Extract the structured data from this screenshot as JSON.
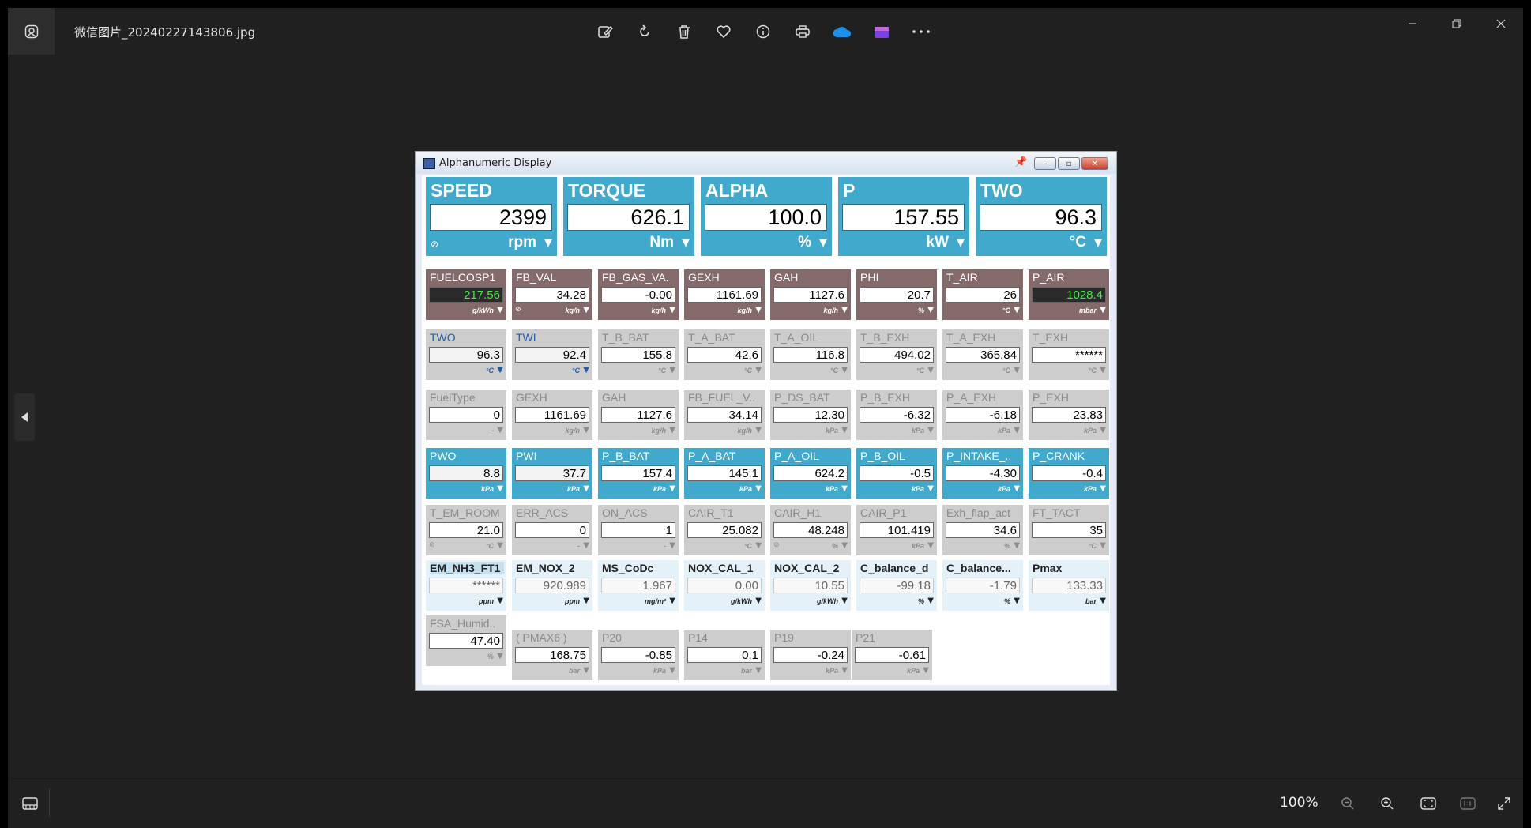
{
  "viewer": {
    "file_name": "微信图片_20240227143806.jpg",
    "zoom": "100%"
  },
  "app": {
    "title": "Alphanumeric Display"
  },
  "big": [
    {
      "label": "SPEED",
      "value": "2399",
      "unit": "rpm"
    },
    {
      "label": "TORQUE",
      "value": "626.1",
      "unit": "Nm"
    },
    {
      "label": "ALPHA",
      "value": "100.0",
      "unit": "%"
    },
    {
      "label": "P",
      "value": "157.55",
      "unit": "kW"
    },
    {
      "label": "TWO",
      "value": "96.3",
      "unit": "°C"
    }
  ],
  "row1": [
    {
      "label": "FUELCOSP1",
      "value": "217.56",
      "unit": "g/kWh"
    },
    {
      "label": "FB_VAL",
      "value": "34.28",
      "unit": "kg/h"
    },
    {
      "label": "FB_GAS_VA.",
      "value": "-0.00",
      "unit": "kg/h"
    },
    {
      "label": "GEXH",
      "value": "1161.69",
      "unit": "kg/h"
    },
    {
      "label": "GAH",
      "value": "1127.6",
      "unit": "kg/h"
    },
    {
      "label": "PHI",
      "value": "20.7",
      "unit": "%"
    },
    {
      "label": "T_AIR",
      "value": "26",
      "unit": "°C"
    },
    {
      "label": "P_AIR",
      "value": "1028.4",
      "unit": "mbar"
    }
  ],
  "row2": [
    {
      "label": "TWO",
      "value": "96.3",
      "unit": "°C"
    },
    {
      "label": "TWI",
      "value": "92.4",
      "unit": "°C"
    },
    {
      "label": "T_B_BAT",
      "value": "155.8",
      "unit": "°C"
    },
    {
      "label": "T_A_BAT",
      "value": "42.6",
      "unit": "°C"
    },
    {
      "label": "T_A_OIL",
      "value": "116.8",
      "unit": "°C"
    },
    {
      "label": "T_B_EXH",
      "value": "494.02",
      "unit": "°C"
    },
    {
      "label": "T_A_EXH",
      "value": "365.84",
      "unit": "°C"
    },
    {
      "label": "T_EXH",
      "value": "******",
      "unit": "°C"
    }
  ],
  "row3": [
    {
      "label": "FuelType",
      "value": "0",
      "unit": "-"
    },
    {
      "label": "GEXH",
      "value": "1161.69",
      "unit": "kg/h"
    },
    {
      "label": "GAH",
      "value": "1127.6",
      "unit": "kg/h"
    },
    {
      "label": "FB_FUEL_V..",
      "value": "34.14",
      "unit": "kg/h"
    },
    {
      "label": "P_DS_BAT",
      "value": "12.30",
      "unit": "kPa"
    },
    {
      "label": "P_B_EXH",
      "value": "-6.32",
      "unit": "kPa"
    },
    {
      "label": "P_A_EXH",
      "value": "-6.18",
      "unit": "kPa"
    },
    {
      "label": "P_EXH",
      "value": "23.83",
      "unit": "kPa"
    }
  ],
  "row4": [
    {
      "label": "PWO",
      "value": "8.8",
      "unit": "kPa"
    },
    {
      "label": "PWI",
      "value": "37.7",
      "unit": "kPa"
    },
    {
      "label": "P_B_BAT",
      "value": "157.4",
      "unit": "kPa"
    },
    {
      "label": "P_A_BAT",
      "value": "145.1",
      "unit": "kPa"
    },
    {
      "label": "P_A_OIL",
      "value": "624.2",
      "unit": "kPa"
    },
    {
      "label": "P_B_OIL",
      "value": "-0.5",
      "unit": "kPa"
    },
    {
      "label": "P_INTAKE_..",
      "value": "-4.30",
      "unit": "kPa"
    },
    {
      "label": "P_CRANK",
      "value": "-0.4",
      "unit": "kPa"
    }
  ],
  "row5": [
    {
      "label": "T_EM_ROOM",
      "value": "21.0",
      "unit": "°C"
    },
    {
      "label": "ERR_ACS",
      "value": "0",
      "unit": "-"
    },
    {
      "label": "ON_ACS",
      "value": "1",
      "unit": "-"
    },
    {
      "label": "CAIR_T1",
      "value": "25.082",
      "unit": "°C"
    },
    {
      "label": "CAIR_H1",
      "value": "48.248",
      "unit": "%"
    },
    {
      "label": "CAIR_P1",
      "value": "101.419",
      "unit": "kPa"
    },
    {
      "label": "Exh_flap_act",
      "value": "34.6",
      "unit": "%"
    },
    {
      "label": "FT_TACT",
      "value": "35",
      "unit": "°C"
    }
  ],
  "row6": [
    {
      "label": "EM_NH3_FT1",
      "value": "******",
      "unit": "ppm"
    },
    {
      "label": "EM_NOX_2",
      "value": "920.989",
      "unit": "ppm"
    },
    {
      "label": "MS_CoDc",
      "value": "1.967",
      "unit": "mg/m³"
    },
    {
      "label": "NOX_CAL_1",
      "value": "0.00",
      "unit": "g/kWh"
    },
    {
      "label": "NOX_CAL_2",
      "value": "10.55",
      "unit": "g/kWh"
    },
    {
      "label": "C_balance_d",
      "value": "-99.18",
      "unit": "%"
    },
    {
      "label": "C_balance...",
      "value": "-1.79",
      "unit": "%"
    },
    {
      "label": "Pmax",
      "value": "133.33",
      "unit": "bar"
    }
  ],
  "row7": [
    {
      "label": "FSA_Humid..",
      "value": "47.40",
      "unit": "%"
    },
    {
      "label": "( PMAX6 )",
      "value": "168.75",
      "unit": "bar"
    },
    {
      "label": "P20",
      "value": "-0.85",
      "unit": "kPa"
    },
    {
      "label": "P14",
      "value": "0.1",
      "unit": "bar"
    },
    {
      "label": "P19",
      "value": "-0.24",
      "unit": "kPa"
    },
    {
      "label": "P21",
      "value": "-0.61",
      "unit": "kPa"
    }
  ],
  "colors": {
    "panel_blue": "#41a9cc",
    "panel_brown": "#856a6c",
    "panel_gray": "#cdcdcd",
    "panel_pale": "#e4f1f8",
    "green_value": "#44ee44"
  },
  "icons": {
    "viewer_toolbar": [
      "edit-image-icon",
      "rotate-icon",
      "delete-icon",
      "favorite-icon",
      "info-icon",
      "print-icon",
      "onedrive-icon",
      "clipchamp-icon",
      "more-icon"
    ],
    "window": [
      "minimize-icon",
      "restore-icon",
      "close-icon"
    ]
  }
}
